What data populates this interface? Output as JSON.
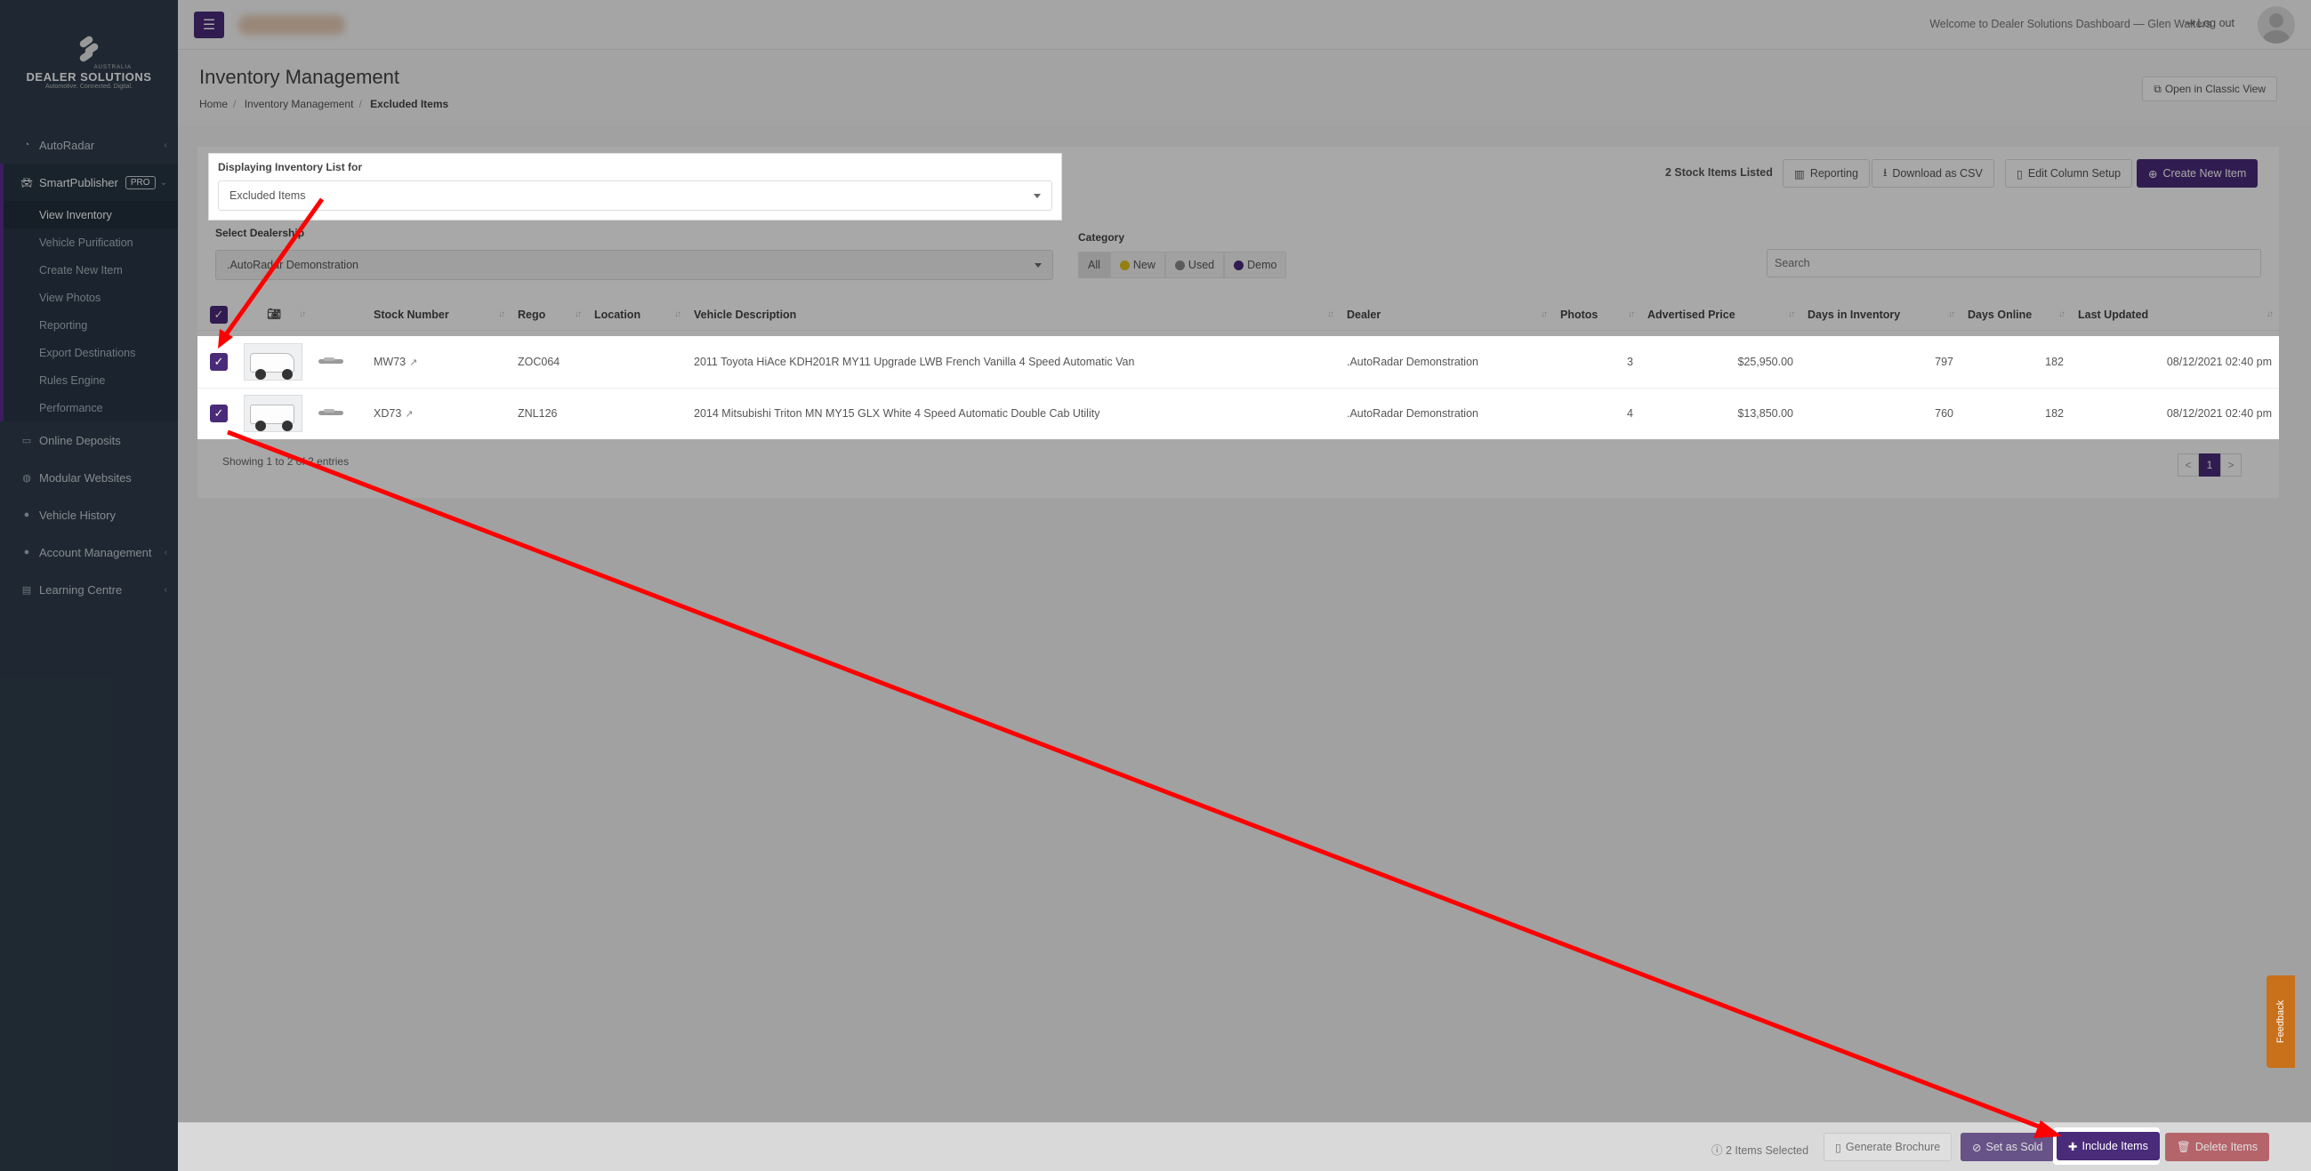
{
  "brand": {
    "country": "AUSTRALIA",
    "name": "DEALER SOLUTIONS",
    "tagline": "Automotive. Connected. Digital."
  },
  "sidebar": {
    "items": [
      {
        "label": "AutoRadar",
        "icon": "gauge-icon",
        "chevron": "‹"
      },
      {
        "label": "SmartPublisher",
        "icon": "car-icon",
        "badge": "PRO",
        "chevron": "⌄"
      },
      {
        "label": "Online Deposits",
        "icon": "card-icon"
      },
      {
        "label": "Modular Websites",
        "icon": "globe-icon"
      },
      {
        "label": "Vehicle History",
        "icon": "circle-icon"
      },
      {
        "label": "Account Management",
        "icon": "user-icon",
        "chevron": "‹"
      },
      {
        "label": "Learning Centre",
        "icon": "book-icon",
        "chevron": "‹"
      }
    ],
    "sub_items": [
      "View Inventory",
      "Vehicle Purification",
      "Create New Item",
      "View Photos",
      "Reporting",
      "Export Destinations",
      "Rules Engine",
      "Performance"
    ]
  },
  "topbar": {
    "menu_icon": "☰",
    "welcome": "Welcome to Dealer Solutions Dashboard — Glen Walters",
    "logout": "Log out"
  },
  "header": {
    "title": "Inventory Management",
    "breadcrumb": [
      "Home",
      "Inventory Management",
      "Excluded Items"
    ],
    "classic_view": "Open in Classic View"
  },
  "filters": {
    "display_label": "Displaying Inventory List for",
    "display_value": "Excluded Items",
    "dealership_label": "Select Dealership",
    "dealership_value": ".AutoRadar Demonstration",
    "category_label": "Category",
    "categories": [
      {
        "label": "All",
        "color": ""
      },
      {
        "label": "New",
        "color": "#e3c11a"
      },
      {
        "label": "Used",
        "color": "#8a8a8a"
      },
      {
        "label": "Demo",
        "color": "#4a2b7a"
      }
    ],
    "search_placeholder": "Search"
  },
  "toolbar": {
    "stock_count": "2 Stock Items Listed",
    "reporting": "Reporting",
    "download_csv": "Download as CSV",
    "edit_columns": "Edit Column Setup",
    "create_new": "Create New Item"
  },
  "table": {
    "headers": [
      "Stock Number",
      "Rego",
      "Location",
      "Vehicle Description",
      "Dealer",
      "Photos",
      "Advertised Price",
      "Days in Inventory",
      "Days Online",
      "Last Updated"
    ],
    "rows": [
      {
        "stock": "MW73",
        "rego": "ZOC064",
        "location": "",
        "description": "2011 Toyota HiAce KDH201R MY11 Upgrade LWB French Vanilla 4 Speed Automatic Van",
        "dealer": ".AutoRadar Demonstration",
        "photos": "3",
        "price": "$25,950.00",
        "days_inventory": "797",
        "days_online": "182",
        "updated": "08/12/2021 02:40 pm"
      },
      {
        "stock": "XD73",
        "rego": "ZNL126",
        "location": "",
        "description": "2014 Mitsubishi Triton MN MY15 GLX White 4 Speed Automatic Double Cab Utility",
        "dealer": ".AutoRadar Demonstration",
        "photos": "4",
        "price": "$13,850.00",
        "days_inventory": "760",
        "days_online": "182",
        "updated": "08/12/2021 02:40 pm"
      }
    ],
    "showing": "Showing 1 to 2 of 2 entries",
    "pager": [
      "<",
      "1",
      ">"
    ]
  },
  "bottombar": {
    "selected": "2 Items Selected",
    "generate_brochure": "Generate Brochure",
    "set_sold": "Set as Sold",
    "include_items": "Include Items",
    "delete_items": "Delete Items"
  },
  "feedback": "Feedback",
  "colors": {
    "accent": "#4a2b7a",
    "danger": "#c0464f",
    "sidebar": "#2f3e4c",
    "arrow": "#ff0000"
  }
}
